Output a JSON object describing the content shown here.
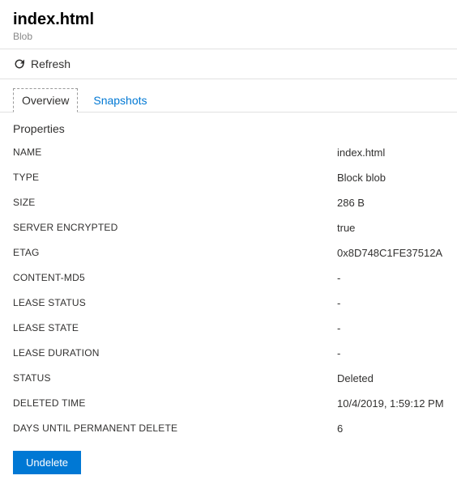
{
  "header": {
    "title": "index.html",
    "subtitle": "Blob"
  },
  "toolbar": {
    "refresh_label": "Refresh"
  },
  "tabs": {
    "overview": "Overview",
    "snapshots": "Snapshots"
  },
  "section_title": "Properties",
  "properties": [
    {
      "label": "NAME",
      "value": "index.html"
    },
    {
      "label": "TYPE",
      "value": "Block blob"
    },
    {
      "label": "SIZE",
      "value": "286 B"
    },
    {
      "label": "SERVER ENCRYPTED",
      "value": "true"
    },
    {
      "label": "ETAG",
      "value": "0x8D748C1FE37512A"
    },
    {
      "label": "CONTENT-MD5",
      "value": "-"
    },
    {
      "label": "LEASE STATUS",
      "value": "-"
    },
    {
      "label": "LEASE STATE",
      "value": "-"
    },
    {
      "label": "LEASE DURATION",
      "value": "-"
    },
    {
      "label": "STATUS",
      "value": "Deleted"
    },
    {
      "label": "DELETED TIME",
      "value": "10/4/2019, 1:59:12 PM"
    },
    {
      "label": "DAYS UNTIL PERMANENT DELETE",
      "value": "6"
    }
  ],
  "footer": {
    "undelete_label": "Undelete"
  }
}
